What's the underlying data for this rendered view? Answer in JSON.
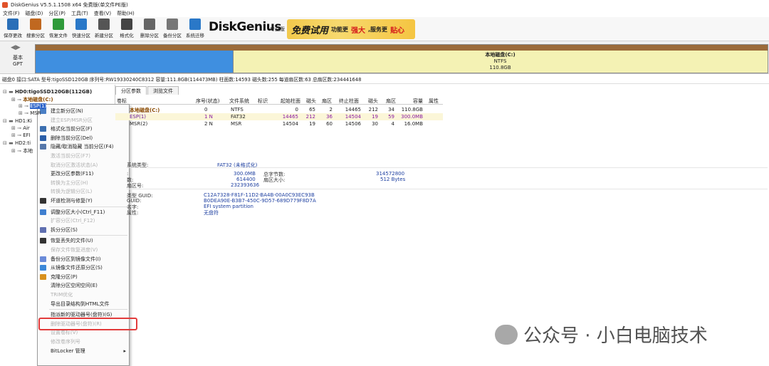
{
  "window": {
    "title": "DiskGenius V5.5.1.1508 x64 免费版(单文件PE版)"
  },
  "menu": [
    "文件(F)",
    "磁盘(D)",
    "分区(P)",
    "工具(T)",
    "查看(V)",
    "帮助(H)"
  ],
  "toolbar": [
    {
      "label": "保存更改",
      "icon": "save-icon",
      "color": "#2a6fb8"
    },
    {
      "label": "搜索分区",
      "icon": "search-icon",
      "color": "#c06820"
    },
    {
      "label": "恢复文件",
      "icon": "recover-file-icon",
      "color": "#2f9a3a"
    },
    {
      "label": "快速分区",
      "icon": "quick-partition-icon",
      "color": "#2a78c8"
    },
    {
      "label": "新建分区",
      "icon": "new-partition-icon",
      "color": "#555"
    },
    {
      "label": "格式化",
      "icon": "format-icon",
      "color": "#444"
    },
    {
      "label": "删除分区",
      "icon": "delete-partition-icon",
      "color": "#666"
    },
    {
      "label": "备份分区",
      "icon": "backup-partition-icon",
      "color": "#777"
    },
    {
      "label": "系统迁移",
      "icon": "system-migrate-icon",
      "color": "#2a78c8"
    }
  ],
  "brand": {
    "name": "DiskGenius",
    "edition": "专业版",
    "promo_big": "免费试用",
    "promo_text1": "功能更",
    "promo_red1": "强大",
    "promo_text2": ",服务更",
    "promo_red2": "贴心"
  },
  "disk_panel": {
    "basic": "基本",
    "gpt": "GPT",
    "part_name": "本地磁盘(C:)",
    "part_fs": "NTFS",
    "part_size": "110.8GB"
  },
  "info_bar": "磁盘0 接口:SATA  型号:tigoSSD120GB  序列号:RW19330240C8312  容量:111.8GB(114473MB)  柱面数:14593  磁头数:255  每道扇区数:63  总扇区数:234441648",
  "tree": [
    {
      "label": "HD0:tigoSSD120GB(112GB)",
      "bold": true
    },
    {
      "label": "本地磁盘(C:)",
      "cls": "brown"
    },
    {
      "label": "ESP(1)",
      "cls": "sel"
    },
    {
      "label": "MSR"
    },
    {
      "label": "HD1:Ki"
    },
    {
      "label": "Air"
    },
    {
      "label": "EFI"
    },
    {
      "label": "HD2:ti"
    },
    {
      "label": "本地"
    }
  ],
  "tabs": [
    "分区参数",
    "浏览文件"
  ],
  "table": {
    "headers": [
      "卷标",
      "序号(状态)",
      "文件系统",
      "标识",
      "起始柱面",
      "磁头",
      "扇区",
      "终止柱面",
      "磁头",
      "扇区",
      "容量",
      "属性"
    ],
    "rows": [
      {
        "name": "本地磁盘(C:)",
        "no": "0",
        "fs": "NTFS",
        "id": "",
        "sc": "0",
        "sh": "65",
        "ss": "2",
        "ec": "14465",
        "eh": "212",
        "es": "34",
        "size": "110.8GB",
        "cls": "brown"
      },
      {
        "name": "ESP(1)",
        "no": "1 N",
        "fs": "FAT32",
        "id": "",
        "sc": "14465",
        "sh": "212",
        "ss": "36",
        "ec": "14504",
        "eh": "19",
        "es": "59",
        "size": "300.0MB",
        "cls": "purple"
      },
      {
        "name": "MSR(2)",
        "no": "2 N",
        "fs": "MSR",
        "id": "",
        "sc": "14504",
        "sh": "19",
        "ss": "60",
        "ec": "14506",
        "eh": "30",
        "es": "4",
        "size": "16.0MB",
        "cls": ""
      }
    ]
  },
  "details": {
    "fs_type_label": "系统类型:",
    "fs_type": "FAT32 (未格式化)",
    "cap_label": ":",
    "cap": "300.0MB",
    "total_bytes_label": "总字节数:",
    "total_bytes": "314572800",
    "sectors_label": "数:",
    "sectors": "614400",
    "sector_size_label": "扇区大小:",
    "sector_size": "512 Bytes",
    "start_label": "扇区号:",
    "start": "232393636",
    "type_guid_label": "类型 GUID:",
    "type_guid": "C12A7328-F81F-11D2-BA4B-00A0C93EC93B",
    "guid_label": "GUID:",
    "guid": "B0DEA90E-B3B7-450C-9D57-689D779F8D7A",
    "name_label": "名字:",
    "name": "EFI system partition",
    "attr_label": "属性:",
    "attr": "无盘符"
  },
  "context_menu": [
    {
      "label": "建立新分区(N)",
      "dis": false,
      "icon": "#4a7fc4"
    },
    {
      "label": "建立ESP/MSR分区",
      "dis": true
    },
    {
      "label": "格式化当前分区(F)",
      "dis": false,
      "icon": "#3b6fb0"
    },
    {
      "label": "删除当前分区(Del)",
      "dis": false,
      "icon": "#2a5ea8"
    },
    {
      "label": "隐藏/取消隐藏 当前分区(F4)",
      "dis": false,
      "icon": "#5577aa"
    },
    {
      "label": "激活当前分区(F7)",
      "dis": true
    },
    {
      "label": "取消分区激活状态(A)",
      "dis": true
    },
    {
      "label": "更改分区参数(F11)",
      "dis": false
    },
    {
      "label": "转换为主分区(H)",
      "dis": true
    },
    {
      "label": "转换为逻辑分区(L)",
      "dis": true
    },
    {
      "label": "坏道检测与修复(Y)",
      "dis": false,
      "icon": "#333"
    },
    {
      "label": "SEP"
    },
    {
      "label": "调整分区大小(Ctrl_F11)",
      "dis": false,
      "icon": "#3f7fcf"
    },
    {
      "label": "扩容分区(Ctrl_F12)",
      "dis": true
    },
    {
      "label": "拆分分区(S)",
      "dis": false,
      "icon": "#5f6fb0"
    },
    {
      "label": "SEP"
    },
    {
      "label": "恢复丢失的文件(U)",
      "dis": false,
      "icon": "#333"
    },
    {
      "label": "保存文件恢复进度(V)",
      "dis": true
    },
    {
      "label": "备份分区到镜像文件(I)",
      "dis": false,
      "icon": "#6a8ad8"
    },
    {
      "label": "从镜像文件还原分区(S)",
      "dis": false,
      "icon": "#3b88d8"
    },
    {
      "label": "克隆分区(P)",
      "dis": false,
      "icon": "#d8901c"
    },
    {
      "label": "清除分区空闲空间(E)",
      "dis": false
    },
    {
      "label": "TRIM优化",
      "dis": true
    },
    {
      "label": "导出目录结构到HTML文件",
      "dis": false
    },
    {
      "label": "SEP"
    },
    {
      "label": "指派新的驱动器号(盘符)(G)",
      "dis": false
    },
    {
      "label": "删除驱动器号(盘符)(R)",
      "dis": true
    },
    {
      "label": "设置卷标(V)",
      "dis": true
    },
    {
      "label": "修改卷序列号",
      "dis": true
    },
    {
      "label": "BitLocker 管理",
      "dis": false,
      "arrow": "▸"
    }
  ],
  "watermark": "公众号 · 小白电脑技术"
}
